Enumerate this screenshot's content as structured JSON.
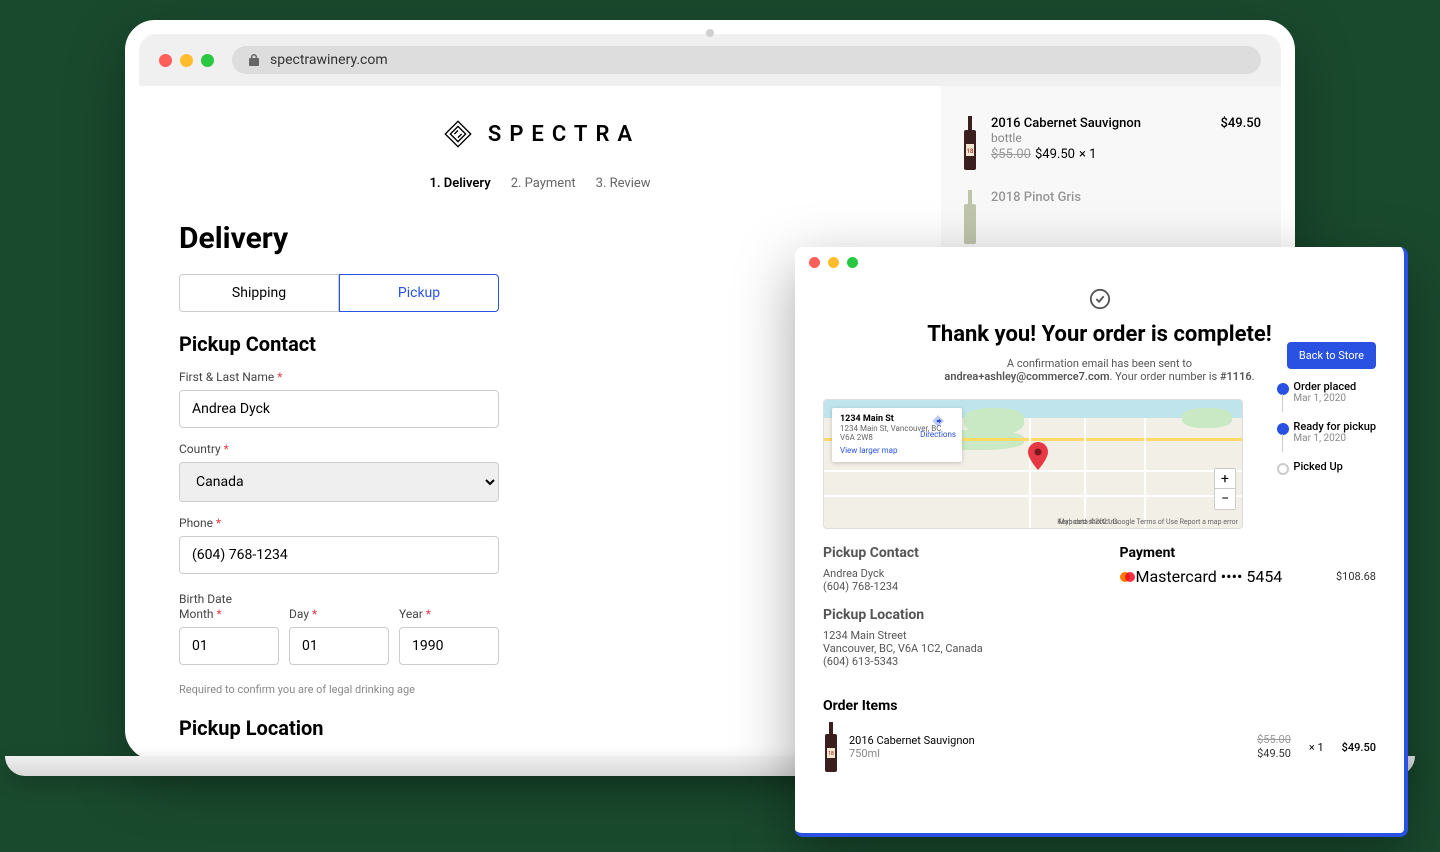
{
  "browser": {
    "url": "spectrawinery.com"
  },
  "brand": {
    "name": "SPECTRA"
  },
  "steps": {
    "s1": "1. Delivery",
    "s2": "2. Payment",
    "s3": "3. Review"
  },
  "page": {
    "title": "Delivery"
  },
  "tabs": {
    "shipping": "Shipping",
    "pickup": "Pickup"
  },
  "sections": {
    "pickupContact": "Pickup Contact",
    "pickupLocation": "Pickup Location"
  },
  "form": {
    "nameLabel": "First & Last Name",
    "nameValue": "Andrea Dyck",
    "countryLabel": "Country",
    "countryValue": "Canada",
    "phoneLabel": "Phone",
    "phoneValue": "(604) 768-1234",
    "birthLabel": "Birth Date",
    "monthLabel": "Month",
    "monthValue": "01",
    "dayLabel": "Day",
    "dayValue": "01",
    "yearLabel": "Year",
    "yearValue": "1990",
    "helper": "Required to confirm you are of legal drinking age",
    "asterisk": "*"
  },
  "cart": {
    "item1_name": "2016 Cabernet Sauvignon",
    "item1_sub": "bottle",
    "item1_orig": "$55.00",
    "item1_price": "$49.50",
    "item1_qty": "× 1",
    "item1_total": "$49.50",
    "item2_name": "2018 Pinot Gris"
  },
  "overlay": {
    "thanks": "Thank you! Your order is complete!",
    "conf_prefix": "A confirmation email has been sent to",
    "conf_email": "andrea+ashley@commerce7.com",
    "conf_mid": ". Your order number is ",
    "conf_order": "#1116",
    "conf_end": ".",
    "backBtn": "Back to Store"
  },
  "map": {
    "addr1": "1234 Main St",
    "addr2": "1234 Main St, Vancouver, BC V6A 2W8",
    "viewLarger": "View larger map",
    "directions": "Directions",
    "keyboard": "Keyboard shortcuts",
    "attribution": "Map data ©2021 Google   Terms of Use   Report a map error"
  },
  "timeline": {
    "t1_title": "Order placed",
    "t1_date": "Mar 1, 2020",
    "t2_title": "Ready for pickup",
    "t2_date": "Mar 1, 2020",
    "t3_title": "Picked Up"
  },
  "details": {
    "pc_title": "Pickup Contact",
    "pc_name": "Andrea Dyck",
    "pc_phone": "(604) 768-1234",
    "pl_title": "Pickup Location",
    "pl_addr1": "1234 Main Street",
    "pl_addr2": "Vancouver, BC, V6A 1C2, Canada",
    "pl_phone": "(604) 613-5343",
    "pay_title": "Payment",
    "pay_method": "Mastercard •••• 5454",
    "pay_amount": "$108.68"
  },
  "orderItems": {
    "title": "Order Items",
    "i1_name": "2016 Cabernet Sauvignon",
    "i1_sub": "750ml",
    "i1_orig": "$55.00",
    "i1_price": "$49.50",
    "i1_qty": "× 1",
    "i1_total": "$49.50"
  }
}
